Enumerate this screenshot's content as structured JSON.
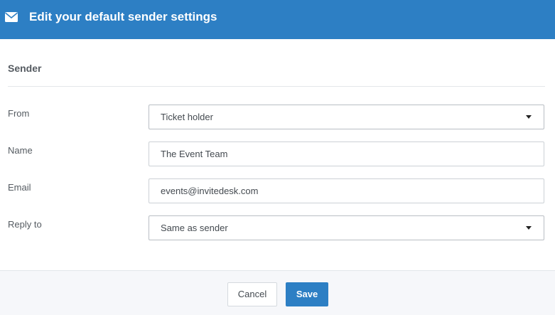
{
  "header": {
    "icon": "envelope-icon",
    "title": "Edit your default sender settings",
    "color": "#2d7fc4"
  },
  "section": {
    "title": "Sender"
  },
  "fields": {
    "from": {
      "label": "From",
      "value": "Ticket holder",
      "type": "select"
    },
    "name": {
      "label": "Name",
      "value": "The Event Team",
      "type": "text"
    },
    "email": {
      "label": "Email",
      "value": "events@invitedesk.com",
      "type": "text"
    },
    "reply_to": {
      "label": "Reply to",
      "value": "Same as sender",
      "type": "select"
    }
  },
  "footer": {
    "cancel_label": "Cancel",
    "save_label": "Save",
    "save_color": "#2d7fc4"
  }
}
